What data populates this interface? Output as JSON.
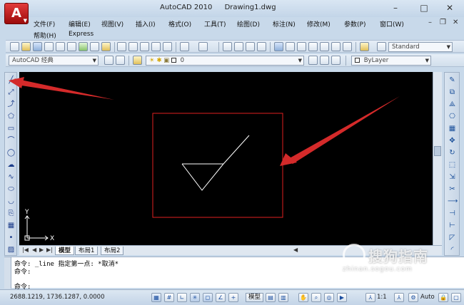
{
  "window": {
    "app_name": "AutoCAD 2010",
    "document": "Drawing1.dwg",
    "minimize": "–",
    "maximize": "□",
    "close": "✕",
    "mdi_minimize": "–",
    "mdi_restore": "❐",
    "mdi_close": "✕"
  },
  "menu": {
    "row1": [
      "文件(F)",
      "编辑(E)",
      "视图(V)",
      "插入(I)",
      "格式(O)",
      "工具(T)",
      "绘图(D)",
      "标注(N)",
      "修改(M)",
      "参数(P)",
      "窗口(W)"
    ],
    "row2": [
      "帮助(H)",
      "Express"
    ]
  },
  "toolbar": {
    "text_style": "Standard",
    "workspace": "AutoCAD 经典",
    "layer": "0",
    "color": "ByLayer"
  },
  "layout_tabs": [
    "模型",
    "布局1",
    "布局2"
  ],
  "drawing": {
    "background": "#000000",
    "highlight_color": "#e02020",
    "annotation_color": "#d42a2a",
    "ucs_y": "Y",
    "ucs_x": "X"
  },
  "command": {
    "lines": [
      "命令: _line 指定第一点: *取消*",
      "命令:",
      "命令:"
    ],
    "prompt": "命令:"
  },
  "status": {
    "coordinates": "2688.1219,  1736.1287, 0.0000",
    "model": "模型",
    "annotation_scale": "1:1",
    "auto": "Auto"
  },
  "watermark": {
    "text": "搜狗指南",
    "url": "zhinan.sogou.com"
  }
}
